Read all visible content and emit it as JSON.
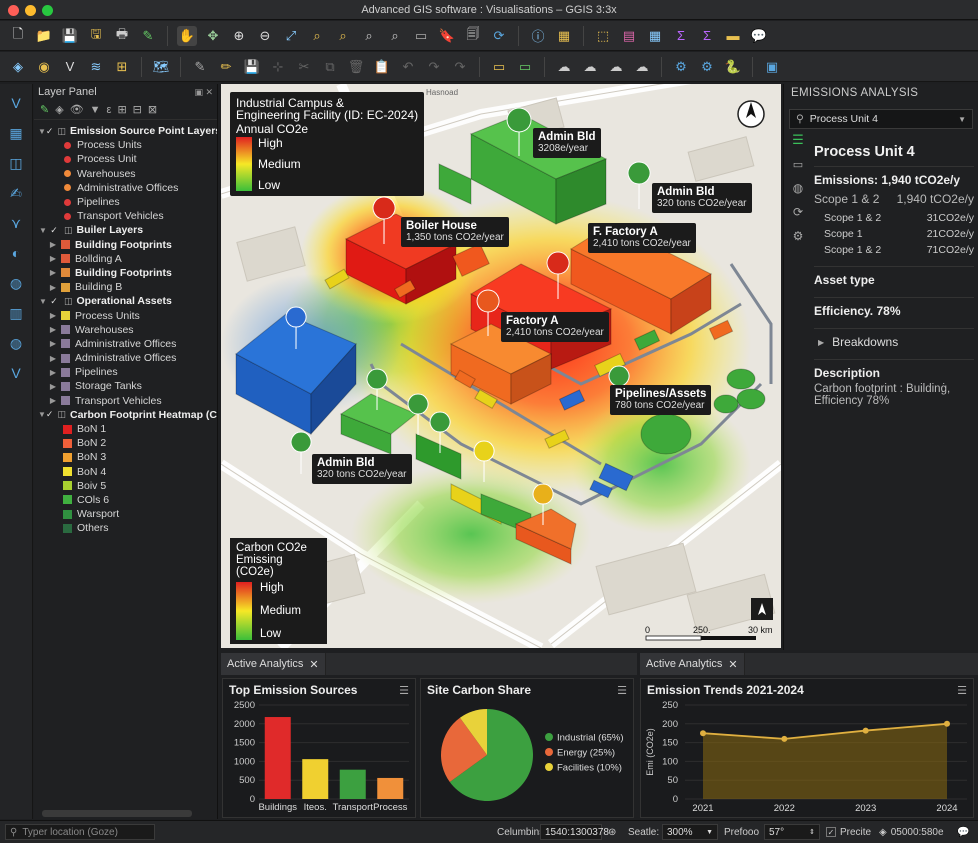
{
  "window": {
    "title": "Advanced GIS software : Visualisations – GGIS 3:3x"
  },
  "layer_panel": {
    "title": "Layer Panel",
    "items": [
      {
        "type": "group",
        "label": "Emission Source Point Layers",
        "open": true,
        "checked": true
      },
      {
        "type": "point",
        "label": "Process Units",
        "color": "#e03a3a"
      },
      {
        "type": "point",
        "label": "Process Unit",
        "color": "#e03a3a"
      },
      {
        "type": "point",
        "label": "Warehouses",
        "color": "#f08a3a"
      },
      {
        "type": "point",
        "label": "Administrative Offices",
        "color": "#f08a3a"
      },
      {
        "type": "point",
        "label": "Pipelines",
        "color": "#e03a3a"
      },
      {
        "type": "point",
        "label": "Transport Vehicles",
        "color": "#e03a3a"
      },
      {
        "type": "group",
        "label": "Builer Layers",
        "open": true,
        "checked": true
      },
      {
        "type": "sub",
        "label": "Building Footprints",
        "color": "#e05a3a",
        "bold": true
      },
      {
        "type": "sub",
        "label": "Bollding A",
        "color": "#e05a3a"
      },
      {
        "type": "sub",
        "label": "Building Footprints",
        "color": "#e08a3a",
        "bold": true
      },
      {
        "type": "sub",
        "label": "Building B",
        "color": "#e0a03a"
      },
      {
        "type": "group",
        "label": "Operational Assets",
        "open": true,
        "checked": true
      },
      {
        "type": "sub",
        "label": "Process Units",
        "color": "#e8d23a"
      },
      {
        "type": "sub",
        "label": "Warehouses",
        "color": "#8a7a9a"
      },
      {
        "type": "sub",
        "label": "Administrative Offices",
        "color": "#8a7a9a"
      },
      {
        "type": "sub",
        "label": "Administrative Offices",
        "color": "#8a7a9a"
      },
      {
        "type": "sub",
        "label": "Pipelines",
        "color": "#8a7a9a"
      },
      {
        "type": "sub",
        "label": "Storage Tanks",
        "color": "#8a7a9a"
      },
      {
        "type": "sub",
        "label": "Transport Vehicles",
        "color": "#8a7a9a"
      },
      {
        "type": "group",
        "label": "Carbon Footprint Heatmap (CC",
        "open": true,
        "checked": true
      },
      {
        "type": "class",
        "label": "BoN 1",
        "color": "#e02020"
      },
      {
        "type": "class",
        "label": "BoN 2",
        "color": "#f0603a"
      },
      {
        "type": "class",
        "label": "BoN 3",
        "color": "#f0a030"
      },
      {
        "type": "class",
        "label": "BoN 4",
        "color": "#f0e030"
      },
      {
        "type": "class",
        "label": "Boiv 5",
        "color": "#a8d030"
      },
      {
        "type": "class",
        "label": "COls 6",
        "color": "#40b040"
      },
      {
        "type": "class",
        "label": "Warsport",
        "color": "#309040"
      },
      {
        "type": "class",
        "label": "Others",
        "color": "#2a6a40"
      }
    ]
  },
  "map": {
    "title_line1": "Industrial Campus &",
    "title_line2": "Engineering Facility (ID: EC-2024)",
    "legend_top": {
      "title": "Annual CO2e",
      "high": "High",
      "medium": "Medium",
      "low": "Low"
    },
    "legend_bottom": {
      "title_line1": "Carbon CO2e",
      "title_line2": "Emissing (CO2e)",
      "high": "High",
      "medium": "Medium",
      "low": "Low"
    },
    "street_label": "Hasnoad",
    "labels": [
      {
        "title": "Admin Bld",
        "sub": "3208e/year"
      },
      {
        "title": "Admin Bld",
        "sub": "320 tons CO2e/year"
      },
      {
        "title": "Boiler House",
        "sub": "1,350 tons CO2e/year"
      },
      {
        "title": "F. Factory A",
        "sub": "2,410 tons CO2e/year"
      },
      {
        "title": "Factory A",
        "sub": "2,410 tons CO2e/year"
      },
      {
        "title": "Pipelines/Assets",
        "sub": "780 tons CO2e/year"
      },
      {
        "title": "Admin Bld",
        "sub": "320 tons CO2e/year"
      }
    ],
    "scale": {
      "zero": "0",
      "mid": "250.",
      "end": "30 km"
    }
  },
  "right_panel": {
    "title": "EMISSIONS ANALYSIS",
    "dropdown": "Process Unit 4",
    "heading": "Process Unit 4",
    "emissions": "Emissions: 1,940 tCO2e/y",
    "scope_header": "Scope 1 & 2",
    "scope_header_value": "1,940 tCO2e/y",
    "scopes": [
      {
        "label": "Scope 1 & 2",
        "value": "31CO2e/y"
      },
      {
        "label": "Scope 1",
        "value": "21CO2e/y"
      },
      {
        "label": "Scope 1 & 2",
        "value": "71CO2e/y"
      }
    ],
    "asset_type": "Asset type",
    "efficiency": "Efficiency. 78%",
    "breakdowns": "Breakdowns",
    "description_title": "Description",
    "description_line1": "Carbon footprint : Buildinġ,",
    "description_line2": "Efficiency 78%"
  },
  "bottom_tabs": {
    "tab1": "Active Analytics",
    "tab2": "Active Analytics"
  },
  "charts": {
    "top_sources_title": "Top Emission Sources",
    "site_share_title": "Site Carbon Share",
    "trends_title": "Emission Trends 2021-2024"
  },
  "chart_data": [
    {
      "type": "bar",
      "title": "Top Emission Sources",
      "categories": [
        "Buildings",
        "Iteos.",
        "Transport",
        "Process"
      ],
      "values": [
        2180,
        1060,
        780,
        560
      ],
      "colors": [
        "#e02a2a",
        "#f0d030",
        "#3ca040",
        "#f0903a"
      ],
      "ylim": [
        0,
        2500
      ],
      "yticks": [
        "0",
        "500",
        "1000",
        "1500",
        "2000",
        "2500"
      ]
    },
    {
      "type": "pie",
      "title": "Site Carbon Share",
      "labels": [
        "Industrial (65%)",
        "Energy (25%)",
        "Facilities (10%)"
      ],
      "values": [
        65,
        25,
        10
      ],
      "colors": [
        "#3ca040",
        "#e8683a",
        "#e8d23a"
      ]
    },
    {
      "type": "line",
      "title": "Emission Trends 2021-2024",
      "x": [
        "2021",
        "2022",
        "2023",
        "2024"
      ],
      "y": [
        175,
        160,
        182,
        200
      ],
      "ylim": [
        0,
        250
      ],
      "yticks": [
        "0",
        "50",
        "100",
        "150",
        "200",
        "250"
      ],
      "ylabel": "Emi (CO2e)",
      "color": "#e0b040"
    }
  ],
  "statusbar": {
    "search_placeholder": "Typer location (Goze)",
    "coord_label": "Celumbins:",
    "coord_value": "1540:1300378",
    "scale_label": "Seatle:",
    "scale_value": "300%",
    "pref_label": "Prefooo",
    "pref_value": "57°",
    "precise_label": "Precite",
    "crs_value": "05000:580e"
  }
}
